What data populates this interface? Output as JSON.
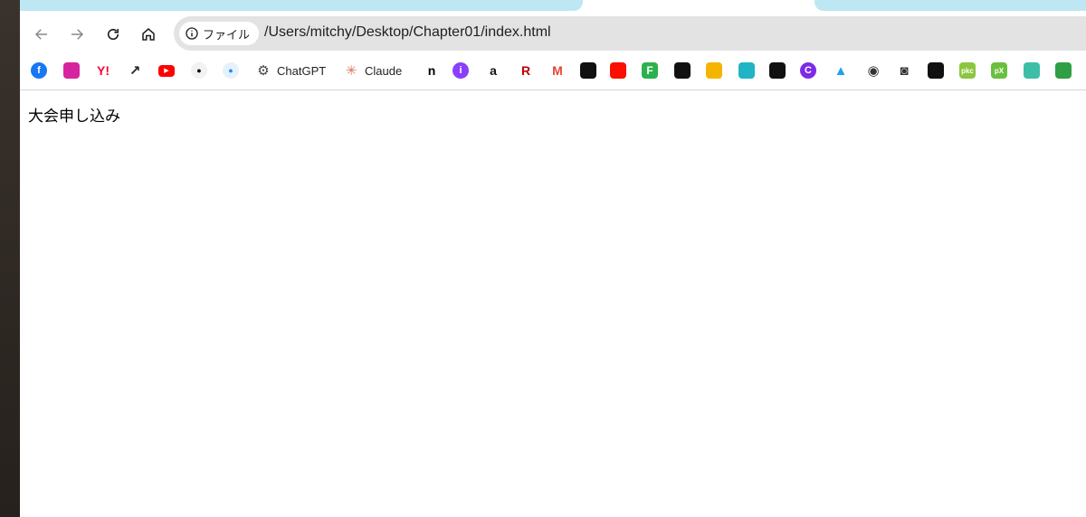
{
  "browser": {
    "address_chip_label": "ファイル",
    "url": "/Users/mitchy/Desktop/Chapter01/index.html"
  },
  "bookmarks": [
    {
      "name": "facebook-icon",
      "label": "",
      "color": "#1877f2"
    },
    {
      "name": "instagram-icon",
      "label": "",
      "color": "#d6249f"
    },
    {
      "name": "yahoo-icon",
      "label": "",
      "color": "#ff0033"
    },
    {
      "name": "x-arrow-icon",
      "label": "",
      "color": "#222222"
    },
    {
      "name": "youtube-icon",
      "label": "",
      "color": "#ff0000"
    },
    {
      "name": "apple-icon",
      "label": "",
      "color": "#000000"
    },
    {
      "name": "apple-blue-icon",
      "label": "",
      "color": "#1d8cf8"
    },
    {
      "name": "chatgpt-icon",
      "label": "ChatGPT",
      "color": "#444444"
    },
    {
      "name": "claude-icon",
      "label": "Claude",
      "color": "#d97757"
    },
    {
      "name": "note-icon",
      "label": "",
      "color": "#000000"
    },
    {
      "name": "purple-circle-icon",
      "label": "",
      "color": "#8a3ffc"
    },
    {
      "name": "amazon-icon",
      "label": "",
      "color": "#111111"
    },
    {
      "name": "rakuten-icon",
      "label": "",
      "color": "#bf0000"
    },
    {
      "name": "gmail-icon",
      "label": "",
      "color": "#ea4335"
    },
    {
      "name": "dark-app-icon",
      "label": "",
      "color": "#111111"
    },
    {
      "name": "adobe-icon",
      "label": "",
      "color": "#fa0f00"
    },
    {
      "name": "feedly-icon",
      "label": "",
      "color": "#2bb24c"
    },
    {
      "name": "black-k-icon",
      "label": "",
      "color": "#111111"
    },
    {
      "name": "xmind-icon",
      "label": "",
      "color": "#f5b400"
    },
    {
      "name": "pj-icon",
      "label": "",
      "color": "#1fb5c7"
    },
    {
      "name": "black-square-icon",
      "label": "",
      "color": "#111111"
    },
    {
      "name": "canva-icon",
      "label": "",
      "color": "#7d2ae8"
    },
    {
      "name": "twitter-icon",
      "label": "",
      "color": "#1da1f2"
    },
    {
      "name": "eye-icon",
      "label": "",
      "color": "#333333"
    },
    {
      "name": "camera-icon",
      "label": "",
      "color": "#333333"
    },
    {
      "name": "unsplash-icon",
      "label": "",
      "color": "#111111"
    },
    {
      "name": "pkc-icon",
      "label": "",
      "color": "#8cc63f"
    },
    {
      "name": "pixiv-icon",
      "label": "",
      "color": "#6abf40"
    },
    {
      "name": "teal-icon",
      "label": "",
      "color": "#3dbfa7"
    },
    {
      "name": "green-cat-icon",
      "label": "",
      "color": "#2f9e44"
    }
  ],
  "bookmark_text": {
    "yahoo": "Y!",
    "note": "n",
    "amazon": "a",
    "rakuten": "R",
    "gmail": "M",
    "feedly": "F",
    "pkc": "pkc",
    "pixiv": "pX"
  },
  "page": {
    "heading": "大会申し込み"
  }
}
